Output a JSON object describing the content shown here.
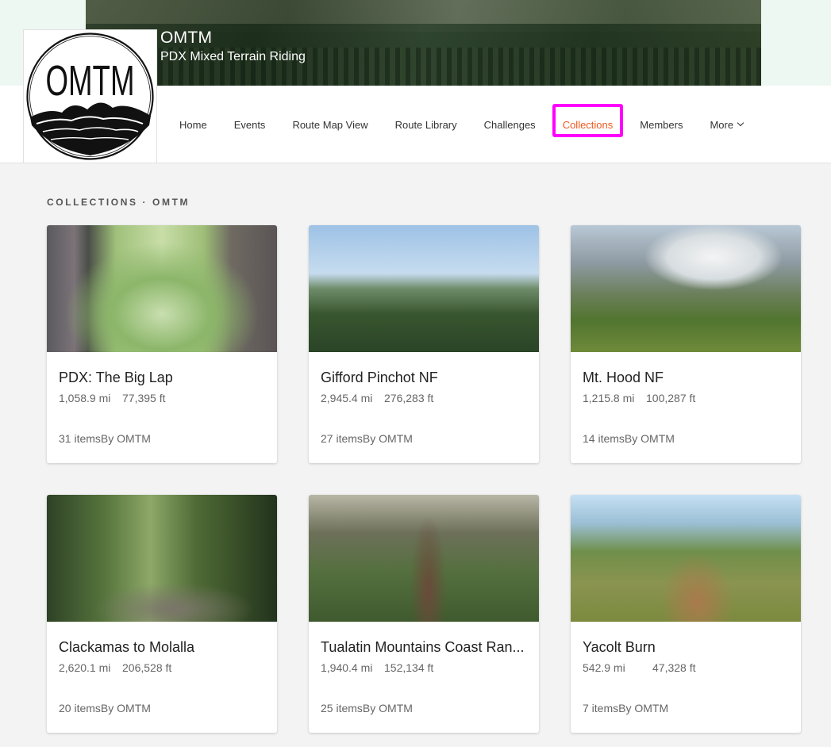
{
  "club": {
    "name": "OMTM",
    "subtitle": "PDX Mixed Terrain Riding",
    "logo_text": "OMTM"
  },
  "nav": {
    "items": [
      {
        "label": "Home"
      },
      {
        "label": "Events"
      },
      {
        "label": "Route Map View"
      },
      {
        "label": "Route Library"
      },
      {
        "label": "Challenges"
      },
      {
        "label": "Collections",
        "active": true
      },
      {
        "label": "Members"
      },
      {
        "label": "More",
        "has_dropdown": true
      }
    ]
  },
  "colors": {
    "accent": "#f0581e",
    "highlight": "#ff00ff"
  },
  "section": {
    "title": "COLLECTIONS · OMTM"
  },
  "collections": [
    {
      "title": "PDX: The Big Lap",
      "distance": "1,058.9 mi",
      "elevation": "77,395 ft",
      "items": "31 items",
      "by": "By OMTM"
    },
    {
      "title": "Gifford Pinchot NF",
      "distance": "2,945.4 mi",
      "elevation": "276,283 ft",
      "items": "27 items",
      "by": "By OMTM"
    },
    {
      "title": "Mt. Hood NF",
      "distance": "1,215.8 mi",
      "elevation": "100,287 ft",
      "items": "14 items",
      "by": "By OMTM"
    },
    {
      "title": "Clackamas to Molalla",
      "distance": "2,620.1 mi",
      "elevation": "206,528 ft",
      "items": "20 items",
      "by": "By OMTM"
    },
    {
      "title": "Tualatin Mountains Coast Ran...",
      "distance": "1,940.4 mi",
      "elevation": "152,134 ft",
      "items": "25 items",
      "by": "By OMTM"
    },
    {
      "title": "Yacolt Burn",
      "distance": "542.9 mi",
      "elevation": "47,328 ft",
      "items": "7 items",
      "by": "By OMTM"
    }
  ]
}
